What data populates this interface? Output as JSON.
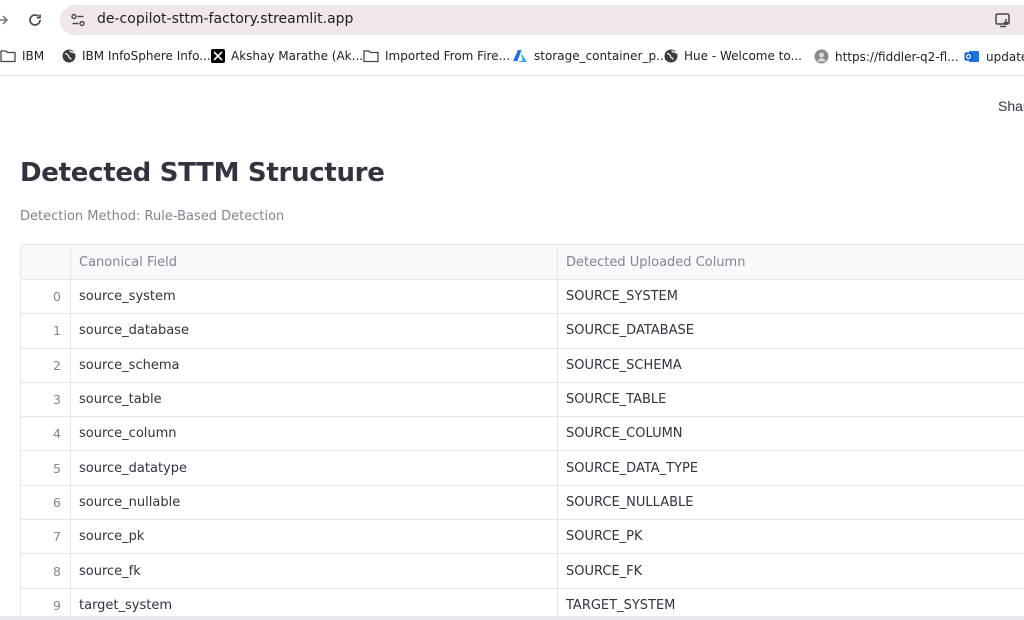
{
  "browser": {
    "url": "de-copilot-sttm-factory.streamlit.app",
    "bookmarks": [
      {
        "label": "IBM",
        "icon": "folder-icon"
      },
      {
        "label": "IBM InfoSphere Info...",
        "icon": "globe-icon"
      },
      {
        "label": "Akshay Marathe (Ak...",
        "icon": "x-logo-icon"
      },
      {
        "label": "Imported From Fire...",
        "icon": "folder-icon"
      },
      {
        "label": "storage_container_p...",
        "icon": "azure-icon"
      },
      {
        "label": "Hue - Welcome to...",
        "icon": "globe-icon"
      },
      {
        "label": "https://fiddler-q2-fl...",
        "icon": "avatar-icon"
      },
      {
        "label": "update",
        "icon": "outlook-icon"
      }
    ]
  },
  "app": {
    "share_label": "Shar",
    "title": "Detected STTM Structure",
    "caption": "Detection Method: Rule-Based Detection",
    "table": {
      "columns": [
        "Canonical Field",
        "Detected Uploaded Column"
      ],
      "rows": [
        {
          "index": "0",
          "canonical": "source_system",
          "detected": "SOURCE_SYSTEM"
        },
        {
          "index": "1",
          "canonical": "source_database",
          "detected": "SOURCE_DATABASE"
        },
        {
          "index": "2",
          "canonical": "source_schema",
          "detected": "SOURCE_SCHEMA"
        },
        {
          "index": "3",
          "canonical": "source_table",
          "detected": "SOURCE_TABLE"
        },
        {
          "index": "4",
          "canonical": "source_column",
          "detected": "SOURCE_COLUMN"
        },
        {
          "index": "5",
          "canonical": "source_datatype",
          "detected": "SOURCE_DATA_TYPE"
        },
        {
          "index": "6",
          "canonical": "source_nullable",
          "detected": "SOURCE_NULLABLE"
        },
        {
          "index": "7",
          "canonical": "source_pk",
          "detected": "SOURCE_PK"
        },
        {
          "index": "8",
          "canonical": "source_fk",
          "detected": "SOURCE_FK"
        },
        {
          "index": "9",
          "canonical": "target_system",
          "detected": "TARGET_SYSTEM"
        }
      ]
    }
  },
  "colors": {
    "omnibox_bg": "#efe7e8",
    "text_primary": "#31333f",
    "text_muted": "#808495",
    "grid_border": "#e6e6ea"
  }
}
